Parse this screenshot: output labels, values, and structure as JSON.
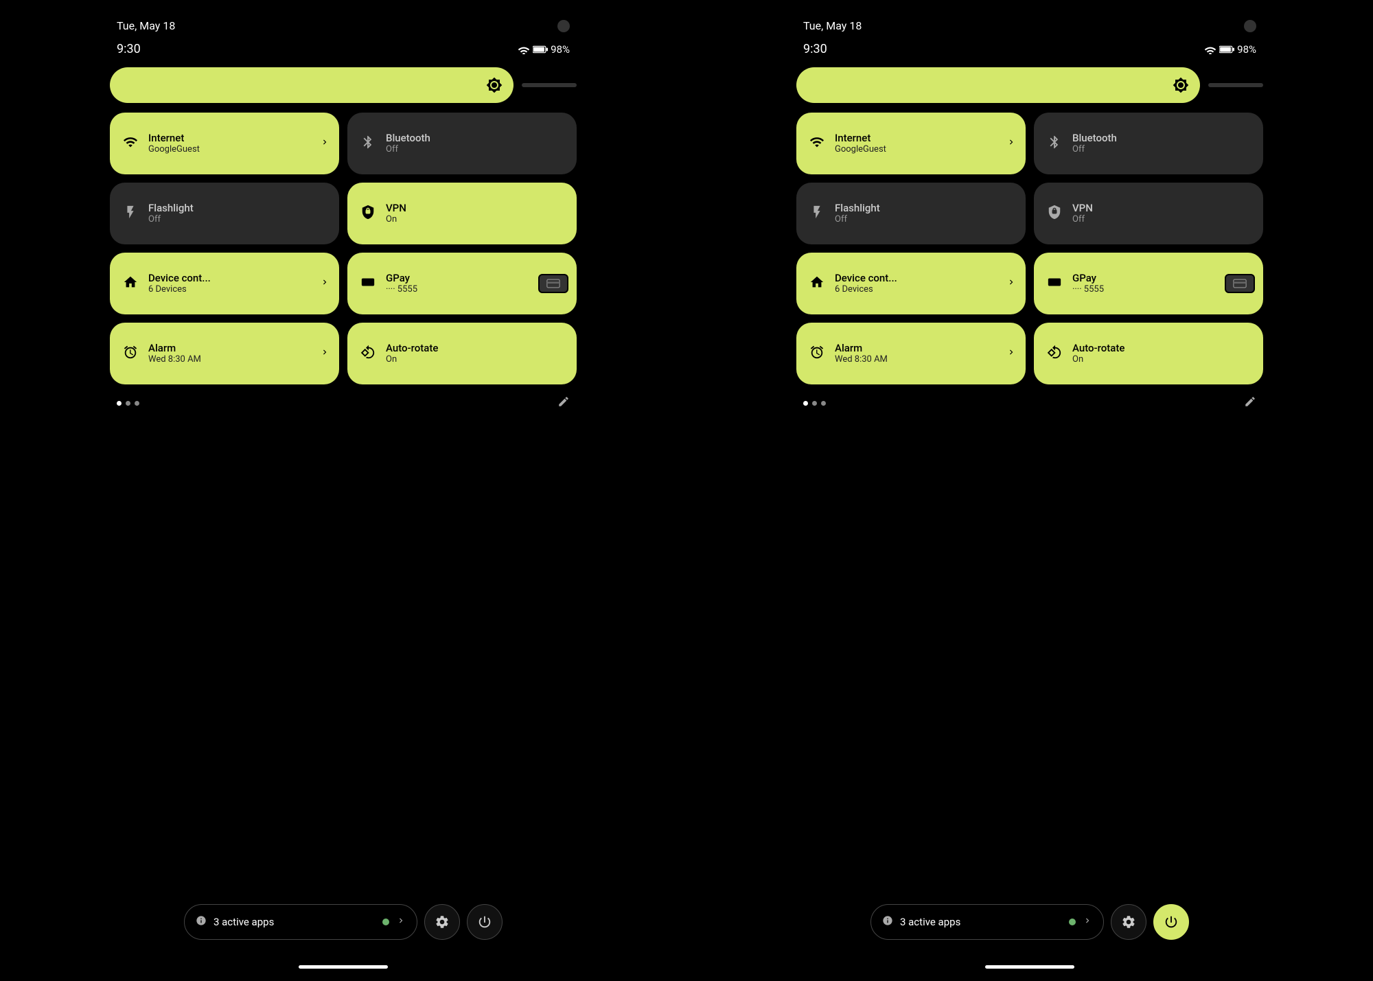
{
  "screens": [
    {
      "id": "screen-left",
      "statusBar": {
        "date": "Tue, May 18",
        "time": "9:30",
        "battery": "98%"
      },
      "brightness": {
        "icon": "⚙"
      },
      "tiles": [
        {
          "id": "internet",
          "title": "Internet",
          "subtitle": "GoogleGuest",
          "active": true,
          "hasArrow": true,
          "icon": "wifi"
        },
        {
          "id": "bluetooth",
          "title": "Bluetooth",
          "subtitle": "Off",
          "active": false,
          "hasArrow": false,
          "icon": "bluetooth"
        },
        {
          "id": "flashlight",
          "title": "Flashlight",
          "subtitle": "Off",
          "active": false,
          "hasArrow": false,
          "icon": "flashlight"
        },
        {
          "id": "vpn",
          "title": "VPN",
          "subtitle": "On",
          "active": true,
          "hasArrow": false,
          "icon": "vpn"
        },
        {
          "id": "device",
          "title": "Device cont...",
          "subtitle": "6 Devices",
          "active": true,
          "hasArrow": true,
          "icon": "device"
        },
        {
          "id": "gpay",
          "title": "GPay",
          "subtitle": "···· 5555",
          "active": true,
          "hasArrow": false,
          "icon": "gpay",
          "hasCard": true
        },
        {
          "id": "alarm",
          "title": "Alarm",
          "subtitle": "Wed 8:30 AM",
          "active": true,
          "hasArrow": true,
          "icon": "alarm"
        },
        {
          "id": "autorotate",
          "title": "Auto-rotate",
          "subtitle": "On",
          "active": true,
          "hasArrow": false,
          "icon": "autorotate"
        }
      ],
      "dots": [
        true,
        false,
        false
      ],
      "bottomBar": {
        "appsLabel": "3 active apps",
        "settingsActive": false,
        "powerActive": false
      }
    },
    {
      "id": "screen-right",
      "statusBar": {
        "date": "Tue, May 18",
        "time": "9:30",
        "battery": "98%"
      },
      "brightness": {
        "icon": "⚙"
      },
      "tiles": [
        {
          "id": "internet",
          "title": "Internet",
          "subtitle": "GoogleGuest",
          "active": true,
          "hasArrow": true,
          "icon": "wifi"
        },
        {
          "id": "bluetooth",
          "title": "Bluetooth",
          "subtitle": "Off",
          "active": false,
          "hasArrow": false,
          "icon": "bluetooth"
        },
        {
          "id": "flashlight",
          "title": "Flashlight",
          "subtitle": "Off",
          "active": false,
          "hasArrow": false,
          "icon": "flashlight"
        },
        {
          "id": "vpn",
          "title": "VPN",
          "subtitle": "Off",
          "active": false,
          "hasArrow": false,
          "icon": "vpn"
        },
        {
          "id": "device",
          "title": "Device cont...",
          "subtitle": "6 Devices",
          "active": true,
          "hasArrow": true,
          "icon": "device"
        },
        {
          "id": "gpay",
          "title": "GPay",
          "subtitle": "···· 5555",
          "active": true,
          "hasArrow": false,
          "icon": "gpay",
          "hasCard": true
        },
        {
          "id": "alarm",
          "title": "Alarm",
          "subtitle": "Wed 8:30 AM",
          "active": true,
          "hasArrow": true,
          "icon": "alarm"
        },
        {
          "id": "autorotate",
          "title": "Auto-rotate",
          "subtitle": "On",
          "active": true,
          "hasArrow": false,
          "icon": "autorotate"
        }
      ],
      "dots": [
        true,
        false,
        false
      ],
      "bottomBar": {
        "appsLabel": "3 active apps",
        "settingsActive": true,
        "powerActive": true
      }
    }
  ],
  "icons": {
    "wifi": "▼",
    "bluetooth": "✱",
    "flashlight": "🔦",
    "vpn": "◉",
    "device": "⌂",
    "gpay": "▬",
    "alarm": "⏰",
    "autorotate": "↻",
    "pencil": "✎",
    "info": "ⓘ",
    "settings": "⚙",
    "power": "⏻"
  }
}
